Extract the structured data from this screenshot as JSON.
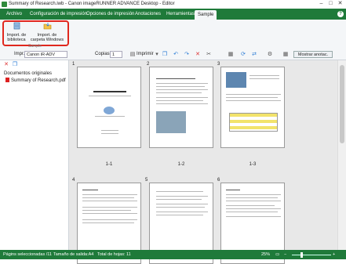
{
  "window": {
    "title": "Summary of Research.iwb - Canon imageRUNNER ADVANCE Desktop - Editor"
  },
  "tabs": [
    "Archivo",
    "Configuración de impresión",
    "Opciones de impresión",
    "Anotaciones",
    "Herramientas",
    "Sample"
  ],
  "ribbon": {
    "buttons": [
      {
        "label": "Import. de biblioteca",
        "icon": "library-import-icon"
      },
      {
        "label": "Import. de carpeta Windows",
        "icon": "folder-import-icon"
      }
    ],
    "group_label": "Sample"
  },
  "toolbar": {
    "printer_label": "Impr.",
    "printer_value": "Canon iR-ADV",
    "copies_label": "Copias",
    "copies_value": "1",
    "print_button": "Imprimir",
    "show_annotations": "Mostrar anotac."
  },
  "left_pane": {
    "header": "Documentos originales",
    "items": [
      "Summary of Research.pdf"
    ]
  },
  "pages": [
    {
      "num": "1",
      "label": "1-1",
      "title": "Summary of Research"
    },
    {
      "num": "2",
      "label": "1-2",
      "title": "Introduction of SPACE EXPLORATION"
    },
    {
      "num": "3",
      "label": "1-3",
      "title": "Introduction"
    },
    {
      "num": "4",
      "label": "",
      "title": "Goals"
    },
    {
      "num": "5",
      "label": "",
      "title": ""
    },
    {
      "num": "6",
      "label": "",
      "title": "Results"
    }
  ],
  "status": {
    "selected": "Págins seleccionadas /11",
    "output_size": "Tamaño de salida:A4",
    "total_sheets": "Total de hojas: 11",
    "zoom": "25%",
    "zoom_level": 0.25
  },
  "colors": {
    "brand_green": "#1f7a3a",
    "highlight_red": "#e0281e"
  }
}
